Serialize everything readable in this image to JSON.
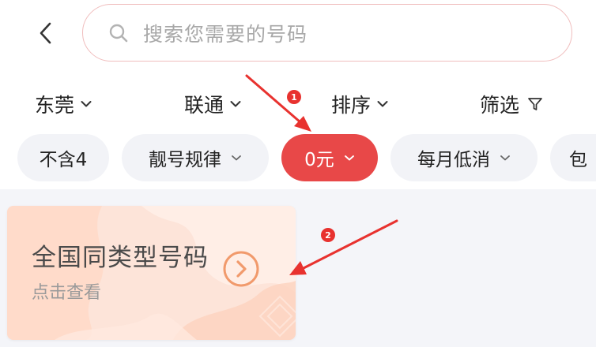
{
  "search": {
    "placeholder": "搜索您需要的号码"
  },
  "filters": [
    {
      "label": "东莞"
    },
    {
      "label": "联通"
    },
    {
      "label": "排序"
    },
    {
      "label": "筛选"
    }
  ],
  "chips": [
    {
      "label": "不含4",
      "has_dropdown": false,
      "active": false
    },
    {
      "label": "靓号规律",
      "has_dropdown": true,
      "active": false
    },
    {
      "label": "0元",
      "has_dropdown": true,
      "active": true
    },
    {
      "label": "每月低消",
      "has_dropdown": true,
      "active": false
    },
    {
      "label": "包",
      "has_dropdown": false,
      "active": false
    }
  ],
  "card": {
    "title": "全国同类型号码",
    "subtitle": "点击查看"
  },
  "annotations": [
    {
      "number": "1"
    },
    {
      "number": "2"
    }
  ],
  "icons": {
    "back": "chevron-left-icon",
    "search": "search-icon",
    "dropdown": "chevron-down-icon",
    "filter": "funnel-icon",
    "card_arrow": "circle-arrow-right-icon"
  },
  "colors": {
    "accent_red": "#e84848",
    "search_border": "#f0bdbd",
    "chip_bg": "#f2f3f7",
    "content_bg": "#f4f5f9",
    "card_bg": "#fde6dc",
    "card_arrow": "#f19a6c"
  }
}
